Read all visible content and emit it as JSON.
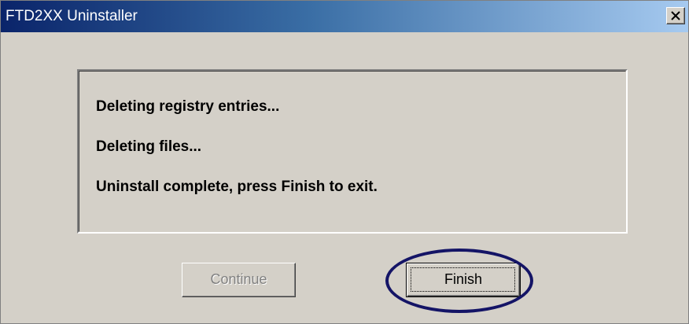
{
  "window": {
    "title": "FTD2XX Uninstaller",
    "close_icon": "close-x-icon"
  },
  "messages": [
    "Deleting registry entries...",
    "Deleting files...",
    "Uninstall complete, press Finish to exit."
  ],
  "buttons": {
    "continue_label": "Continue",
    "continue_enabled": false,
    "finish_label": "Finish",
    "finish_focused": true
  },
  "colors": {
    "titlebar_start": "#0a246a",
    "titlebar_end": "#a6caf0",
    "dialog_bg": "#d4d0c8",
    "highlight_ellipse": "#141466"
  }
}
